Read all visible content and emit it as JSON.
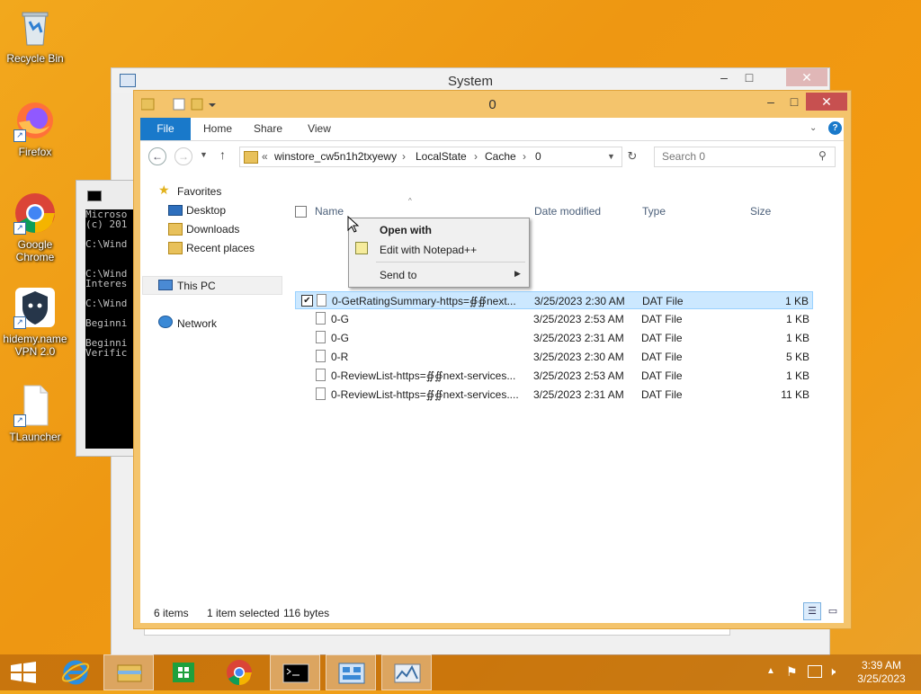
{
  "desktop": {
    "icons": [
      {
        "label": "Recycle Bin"
      },
      {
        "label": "Firefox"
      },
      {
        "label": "Google Chrome"
      },
      {
        "label": "hidemy.name VPN 2.0"
      },
      {
        "label": "TLauncher"
      }
    ]
  },
  "system_window": {
    "title": "System"
  },
  "cmd_window": {
    "lines": "Microso\n(c) 201\n\nC:\\Wind\n\n\nC:\\Wind\nInteres\n\nC:\\Wind\n\nBeginni\n\nBeginni\nVerific"
  },
  "explorer": {
    "title": "0",
    "tabs": [
      "File",
      "Home",
      "Share",
      "View"
    ],
    "address": {
      "prefix": "«",
      "parts": [
        "winstore_cw5n1h2txyewy",
        "LocalState",
        "Cache",
        "0"
      ]
    },
    "search_placeholder": "Search 0",
    "nav": {
      "favorites": "Favorites",
      "desktop": "Desktop",
      "downloads": "Downloads",
      "recent": "Recent places",
      "this_pc": "This PC",
      "network": "Network"
    },
    "columns": {
      "name": "Name",
      "date": "Date modified",
      "type": "Type",
      "size": "Size"
    },
    "files": [
      {
        "name": "0-GetRatingSummary-https=∯∯next...",
        "date": "3/25/2023 2:30 AM",
        "type": "DAT File",
        "size": "1 KB"
      },
      {
        "name": "0-G",
        "date": "3/25/2023 2:53 AM",
        "type": "DAT File",
        "size": "1 KB"
      },
      {
        "name": "0-G",
        "date": "3/25/2023 2:31 AM",
        "type": "DAT File",
        "size": "1 KB"
      },
      {
        "name": "0-R",
        "date": "3/25/2023 2:30 AM",
        "type": "DAT File",
        "size": "5 KB"
      },
      {
        "name": "0-ReviewList-https=∯∯next-services...",
        "date": "3/25/2023 2:53 AM",
        "type": "DAT File",
        "size": "1 KB"
      },
      {
        "name": "0-ReviewList-https=∯∯next-services....",
        "date": "3/25/2023 2:31 AM",
        "type": "DAT File",
        "size": "11 KB"
      }
    ],
    "status": {
      "items": "6 items",
      "selected": "1 item selected",
      "bytes": "116 bytes"
    }
  },
  "context_menu": {
    "open_with": "Open with",
    "edit_notepad": "Edit with Notepad++",
    "send_to": "Send to"
  },
  "taskbar": {
    "time": "3:39 AM",
    "date": "3/25/2023"
  },
  "colors": {
    "accent": "#1979ca",
    "selection": "#cce8ff",
    "desktop": "#f0a01a"
  }
}
